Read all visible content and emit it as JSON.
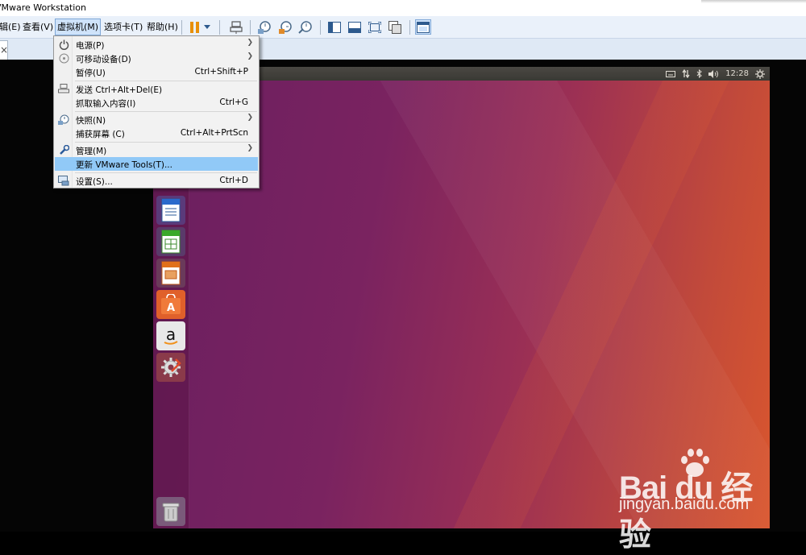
{
  "window": {
    "title": "VMware Workstation"
  },
  "menubar": {
    "items": [
      {
        "label": "编辑(E)"
      },
      {
        "label": "查看(V)"
      },
      {
        "label": "虚拟机(M)"
      },
      {
        "label": "选项卡(T)"
      },
      {
        "label": "帮助(H)"
      }
    ]
  },
  "toolbar": {
    "icons": [
      "pause-icon",
      "dropdown-arrow-icon",
      "send-ctrl-alt-del-icon",
      "snapshot-icon",
      "revert-snapshot-icon",
      "snapshot-manager-icon",
      "show-library-icon",
      "thumbnail-bar-icon",
      "full-screen-icon",
      "unity-icon",
      "console-view-icon"
    ]
  },
  "tabs": [
    {
      "label": "×"
    }
  ],
  "vm_menu": {
    "items": [
      {
        "label": "电源(P)",
        "shortcut": "",
        "submenu": true,
        "icon": "power-icon"
      },
      {
        "label": "可移动设备(D)",
        "shortcut": "",
        "submenu": true,
        "icon": "removable-device-icon"
      },
      {
        "label": "暂停(U)",
        "shortcut": "Ctrl+Shift+P",
        "submenu": false,
        "icon": ""
      },
      {
        "label": "发送 Ctrl+Alt+Del(E)",
        "shortcut": "",
        "submenu": false,
        "icon": "send-ctrl-alt-del-icon"
      },
      {
        "label": "抓取输入内容(I)",
        "shortcut": "Ctrl+G",
        "submenu": false,
        "icon": ""
      },
      {
        "label": "快照(N)",
        "shortcut": "",
        "submenu": true,
        "icon": "snapshot-icon"
      },
      {
        "label": "捕获屏幕 (C)",
        "shortcut": "Ctrl+Alt+PrtScn",
        "submenu": false,
        "icon": ""
      },
      {
        "label": "管理(M)",
        "shortcut": "",
        "submenu": true,
        "icon": "wrench-icon"
      },
      {
        "label": "更新 VMware Tools(T)...",
        "shortcut": "",
        "submenu": false,
        "icon": "",
        "highlighted": true
      },
      {
        "label": "设置(S)...",
        "shortcut": "Ctrl+D",
        "submenu": false,
        "icon": "settings-icon"
      }
    ]
  },
  "guest": {
    "clock": "12:28",
    "launcher": [
      "libreoffice-writer-icon",
      "libreoffice-calc-icon",
      "libreoffice-impress-icon",
      "ubuntu-software-icon",
      "amazon-icon",
      "system-settings-icon",
      "trash-icon"
    ]
  },
  "watermark": {
    "brand": "Bai du 经验",
    "url": "jingyan.baidu.com"
  },
  "colors": {
    "menu_highlight": "#91c9f7",
    "menubar_bg": "#eaf1fa",
    "ubuntu_purple": "#7a2360",
    "ubuntu_orange": "#d9562e"
  }
}
